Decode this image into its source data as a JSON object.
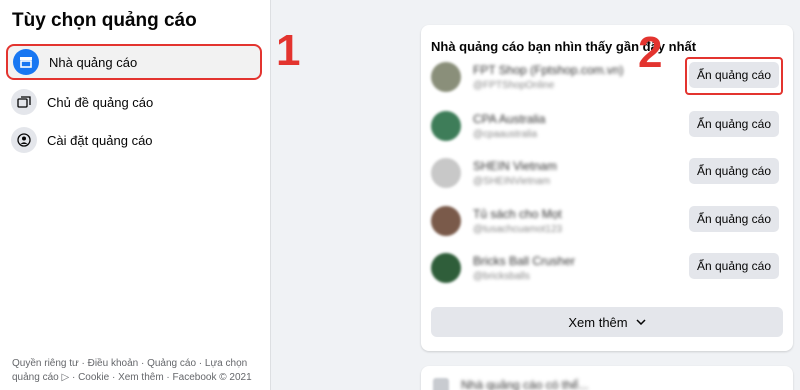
{
  "sidebar": {
    "title": "Tùy chọn quảng cáo",
    "items": [
      {
        "label": "Nhà quảng cáo",
        "icon": "storefront-icon"
      },
      {
        "label": "Chủ đề quảng cáo",
        "icon": "topics-icon"
      },
      {
        "label": "Cài đặt quảng cáo",
        "icon": "user-settings-icon"
      }
    ],
    "footer_line1": "Quyền riêng tư · Điều khoản · Quảng cáo · Lựa chọn",
    "footer_line2": "quảng cáo ▷ · Cookie · Xem thêm · Facebook © 2021"
  },
  "advertisers": {
    "title": "Nhà quảng cáo bạn nhìn thấy gần đây nhất",
    "hide_label": "Ẩn quảng cáo",
    "see_more_label": "Xem thêm",
    "items": [
      {
        "name": "FPT Shop (Fptshop.com.vn)",
        "handle": "@FPTShopOnline",
        "color": "#8a8f7a"
      },
      {
        "name": "CPA Australia",
        "handle": "@cpaaustralia",
        "color": "#3e7d59"
      },
      {
        "name": "SHEIN Vietnam",
        "handle": "@SHEINVietnam",
        "color": "#c8c8c8"
      },
      {
        "name": "Tủ sách cho Mọt",
        "handle": "@tusachcuamot123",
        "color": "#7a5a4a"
      },
      {
        "name": "Bricks Ball Crusher",
        "handle": "@bricksballs",
        "color": "#2f5e3a"
      }
    ]
  },
  "next_section": {
    "title": "Nhà quảng cáo có thể..."
  },
  "annotations": {
    "step1": "1",
    "step2": "2"
  },
  "colors": {
    "accent": "#1877f2",
    "highlight": "#e3342f"
  }
}
